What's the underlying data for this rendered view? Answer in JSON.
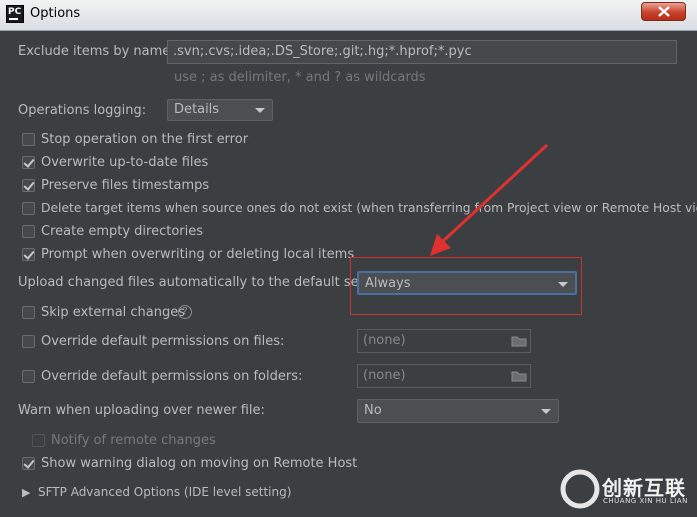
{
  "window": {
    "title": "Options",
    "app_icon": "PC"
  },
  "exclude": {
    "label": "Exclude items by name:",
    "value": ".svn;.cvs;.idea;.DS_Store;.git;.hg;*.hprof;*.pyc",
    "hint": "use ; as delimiter, * and ? as wildcards"
  },
  "logging": {
    "label": "Operations logging:",
    "value": "Details"
  },
  "checkboxes": {
    "stop": {
      "label": "Stop operation on the first error",
      "checked": false
    },
    "overwrite": {
      "label": "Overwrite up-to-date files",
      "checked": true
    },
    "preserve": {
      "label": "Preserve files timestamps",
      "checked": true
    },
    "delete": {
      "label": "Delete target items when source ones do not exist (when transferring from Project view or Remote Host view)",
      "checked": false
    },
    "create": {
      "label": "Create empty directories",
      "checked": false
    },
    "prompt": {
      "label": "Prompt when overwriting or deleting local items",
      "checked": true
    }
  },
  "upload": {
    "label": "Upload changed files automatically to the default server",
    "value": "Always"
  },
  "skip": {
    "label": "Skip external changes",
    "checked": false
  },
  "perm_files": {
    "label": "Override default permissions on files:",
    "value": "(none)",
    "checked": false
  },
  "perm_folders": {
    "label": "Override default permissions on folders:",
    "value": "(none)",
    "checked": false
  },
  "warn": {
    "label": "Warn when uploading over newer file:",
    "value": "No"
  },
  "notify": {
    "label": "Notify of remote changes",
    "checked": false,
    "enabled": false
  },
  "show_warning": {
    "label": "Show warning dialog on moving on Remote Host",
    "checked": true
  },
  "sftp": {
    "label": "SFTP Advanced Options (IDE level setting)"
  },
  "watermark": {
    "brand": "创新互联",
    "sub": "CHUANG XIN HU LIAN"
  },
  "colors": {
    "background": "#3c3f41",
    "text": "#bbbbbb",
    "highlight_border": "#d03030",
    "arrow": "#e03030"
  }
}
